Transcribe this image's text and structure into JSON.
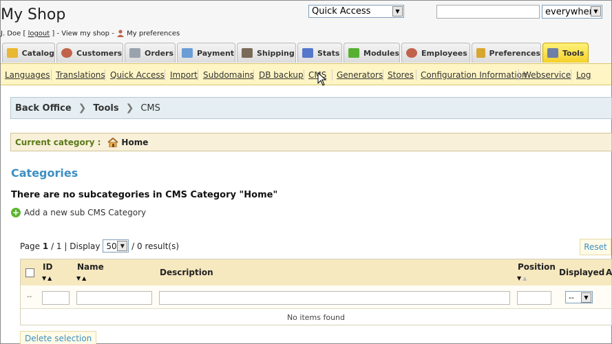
{
  "header": {
    "shop_title": "My Shop",
    "user": {
      "name": "J. Doe",
      "logout": "logout",
      "view_shop": "View my shop",
      "preferences": "My preferences"
    },
    "quick_access": "Quick Access",
    "search_input": "",
    "search_scope": "everywhere"
  },
  "tabs": [
    {
      "label": "Catalog",
      "icon": "folder-icon",
      "color": "#e8b830"
    },
    {
      "label": "Customers",
      "icon": "person-icon",
      "color": "#c0634a"
    },
    {
      "label": "Orders",
      "icon": "cart-icon",
      "color": "#9aa3ad"
    },
    {
      "label": "Payment",
      "icon": "payment-icon",
      "color": "#6b9dd6"
    },
    {
      "label": "Shipping",
      "icon": "truck-icon",
      "color": "#7a6a58"
    },
    {
      "label": "Stats",
      "icon": "chart-icon",
      "color": "#5577cc"
    },
    {
      "label": "Modules",
      "icon": "puzzle-icon",
      "color": "#58b033"
    },
    {
      "label": "Employees",
      "icon": "person-icon",
      "color": "#c0634a"
    },
    {
      "label": "Preferences",
      "icon": "form-icon",
      "color": "#d8a62e"
    },
    {
      "label": "Tools",
      "icon": "wrench-icon",
      "color": "#6c7fa8"
    }
  ],
  "subtabs": [
    "Languages",
    "Translations",
    "Quick Access",
    "Import",
    "Subdomains",
    "DB backup",
    "CMS",
    "Generators",
    "Stores",
    "Configuration Information",
    "Webservice",
    "Log"
  ],
  "breadcrumb": [
    "Back Office",
    "Tools",
    "CMS"
  ],
  "current_category": {
    "label": "Current category :",
    "value": "Home"
  },
  "categories_title": "Categories",
  "no_subcategories": "There are no subcategories in CMS Category \"Home\"",
  "add_sub_category": "Add a new sub CMS Category",
  "pagination": {
    "page_label": "Page",
    "page": "1",
    "of": "/ 1 | Display",
    "per_page": "50",
    "results": "/ 0 result(s)"
  },
  "reset_label": "Reset",
  "grid": {
    "columns": [
      "ID",
      "Name",
      "Description",
      "Position",
      "Displayed",
      "A"
    ],
    "filter_dash": "--",
    "displayed_filter": "--",
    "empty_message": "No items found"
  },
  "delete_selection": "Delete selection"
}
